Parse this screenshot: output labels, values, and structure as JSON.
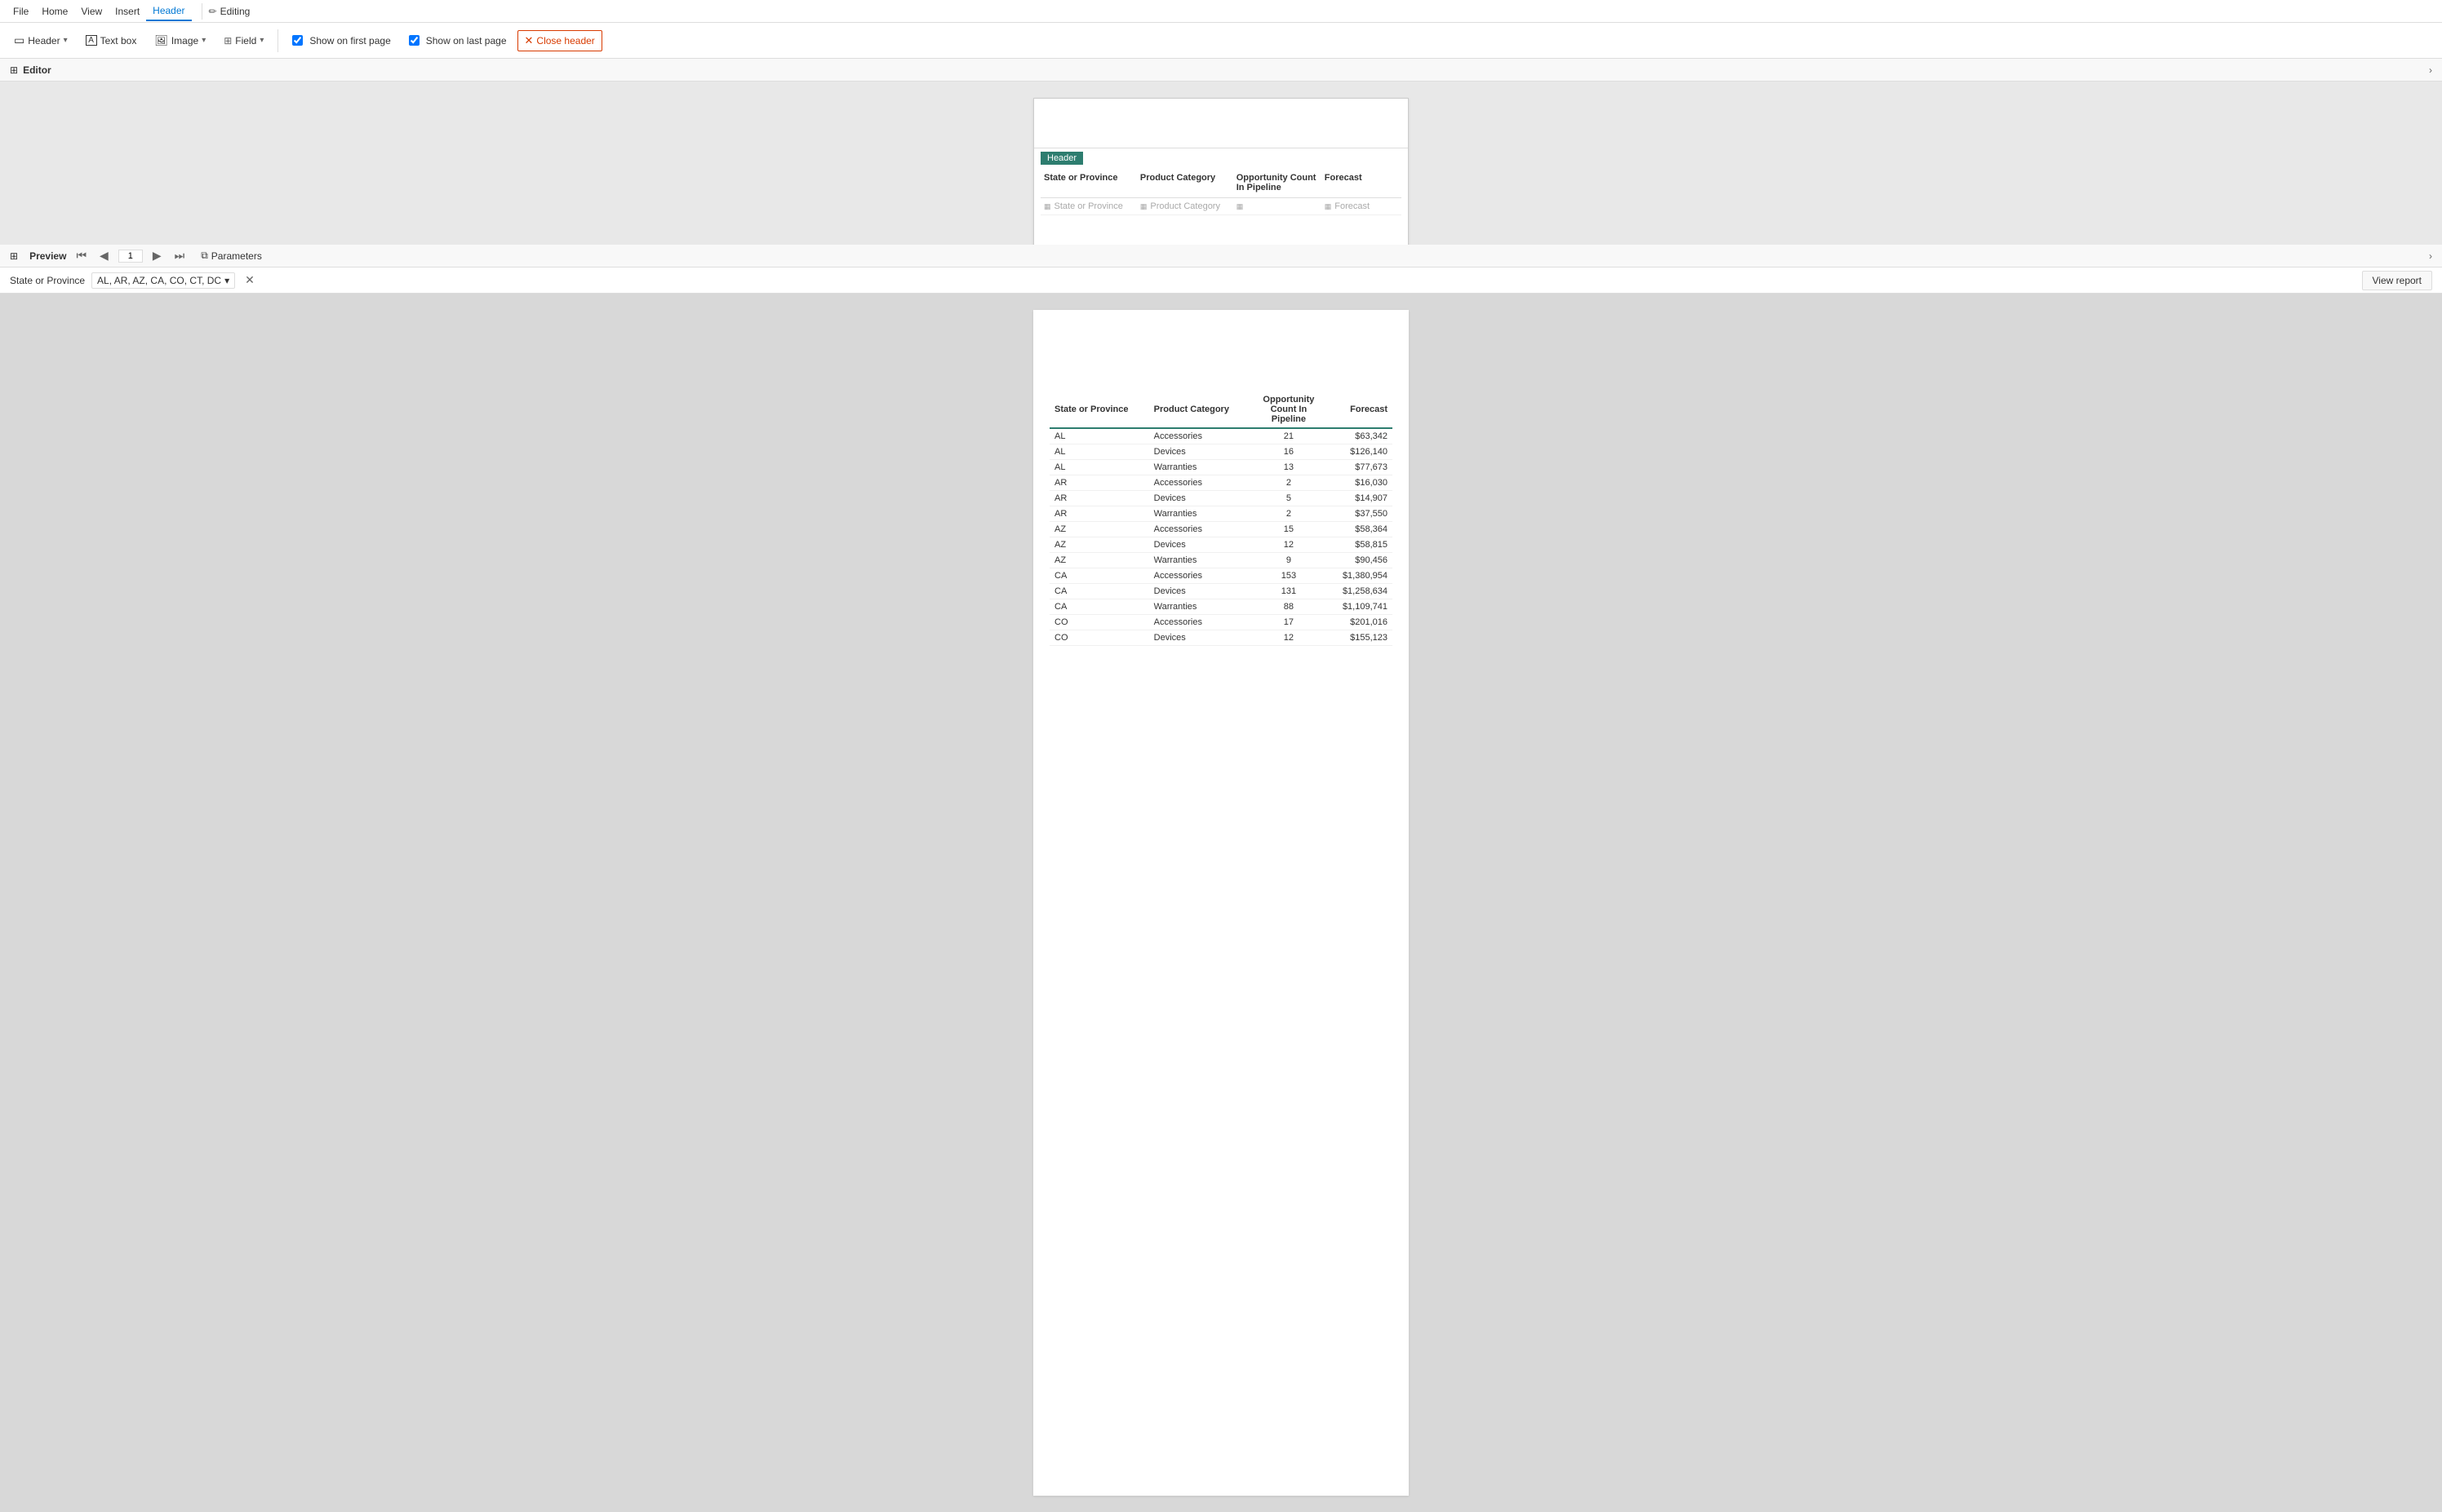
{
  "menubar": {
    "items": [
      "File",
      "Home",
      "View",
      "Insert",
      "Header"
    ]
  },
  "editing_badge": {
    "label": "Editing",
    "icon": "✏"
  },
  "ribbon": {
    "header_label": "Header",
    "textbox_label": "Text box",
    "image_label": "Image",
    "field_label": "Field",
    "show_first_label": "Show on first page",
    "show_last_label": "Show on last page",
    "close_header_label": "Close header"
  },
  "editor": {
    "title": "Editor",
    "header_badge": "Header",
    "columns": [
      "State or Province",
      "Product Category",
      "Opportunity Count In Pipeline",
      "Forecast"
    ],
    "placeholder_row": [
      "State or Province",
      "Product Category",
      "",
      "Forecast"
    ]
  },
  "preview": {
    "title": "Preview",
    "page_number": "1",
    "params_label": "Parameters",
    "state_label": "State or Province",
    "state_value": "AL, AR, AZ, CA, CO, CT, DC",
    "view_report_label": "View report",
    "table_headers": [
      "State or Province",
      "Product Category",
      "Opportunity Count In Pipeline",
      "Forecast"
    ],
    "table_data": [
      [
        "AL",
        "Accessories",
        "21",
        "$63,342"
      ],
      [
        "AL",
        "Devices",
        "16",
        "$126,140"
      ],
      [
        "AL",
        "Warranties",
        "13",
        "$77,673"
      ],
      [
        "AR",
        "Accessories",
        "2",
        "$16,030"
      ],
      [
        "AR",
        "Devices",
        "5",
        "$14,907"
      ],
      [
        "AR",
        "Warranties",
        "2",
        "$37,550"
      ],
      [
        "AZ",
        "Accessories",
        "15",
        "$58,364"
      ],
      [
        "AZ",
        "Devices",
        "12",
        "$58,815"
      ],
      [
        "AZ",
        "Warranties",
        "9",
        "$90,456"
      ],
      [
        "CA",
        "Accessories",
        "153",
        "$1,380,954"
      ],
      [
        "CA",
        "Devices",
        "131",
        "$1,258,634"
      ],
      [
        "CA",
        "Warranties",
        "88",
        "$1,109,741"
      ],
      [
        "CO",
        "Accessories",
        "17",
        "$201,016"
      ],
      [
        "CO",
        "Devices",
        "12",
        "$155,123"
      ]
    ]
  }
}
